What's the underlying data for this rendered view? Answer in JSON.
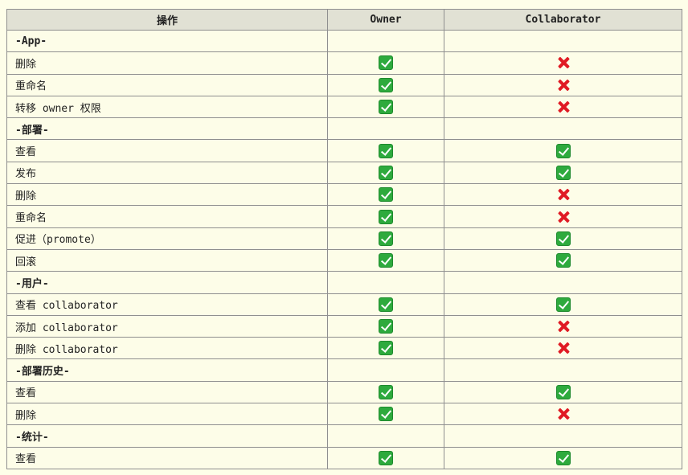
{
  "table": {
    "headers": [
      "操作",
      "Owner",
      "Collaborator"
    ],
    "rows": [
      {
        "kind": "group",
        "label": "-App-"
      },
      {
        "kind": "item",
        "label": "删除",
        "owner": "check-icon",
        "collaborator": "cross-icon"
      },
      {
        "kind": "item",
        "label": "重命名",
        "owner": "check-icon",
        "collaborator": "cross-icon"
      },
      {
        "kind": "item",
        "label": "转移 owner 权限",
        "owner": "check-icon",
        "collaborator": "cross-icon"
      },
      {
        "kind": "group",
        "label": "-部署-"
      },
      {
        "kind": "item",
        "label": "查看",
        "owner": "check-icon",
        "collaborator": "check-icon"
      },
      {
        "kind": "item",
        "label": "发布",
        "owner": "check-icon",
        "collaborator": "check-icon"
      },
      {
        "kind": "item",
        "label": "删除",
        "owner": "check-icon",
        "collaborator": "cross-icon"
      },
      {
        "kind": "item",
        "label": "重命名",
        "owner": "check-icon",
        "collaborator": "cross-icon"
      },
      {
        "kind": "item",
        "label": "促进（promote）",
        "owner": "check-icon",
        "collaborator": "check-icon"
      },
      {
        "kind": "item",
        "label": "回滚",
        "owner": "check-icon",
        "collaborator": "check-icon"
      },
      {
        "kind": "group",
        "label": "-用户-"
      },
      {
        "kind": "item",
        "label": "查看 collaborator",
        "owner": "check-icon",
        "collaborator": "check-icon"
      },
      {
        "kind": "item",
        "label": "添加 collaborator",
        "owner": "check-icon",
        "collaborator": "cross-icon"
      },
      {
        "kind": "item",
        "label": "删除 collaborator",
        "owner": "check-icon",
        "collaborator": "cross-icon"
      },
      {
        "kind": "group",
        "label": "-部署历史-"
      },
      {
        "kind": "item",
        "label": "查看",
        "owner": "check-icon",
        "collaborator": "check-icon"
      },
      {
        "kind": "item",
        "label": "删除",
        "owner": "check-icon",
        "collaborator": "cross-icon"
      },
      {
        "kind": "group",
        "label": "-统计-"
      },
      {
        "kind": "item",
        "label": "查看",
        "owner": "check-icon",
        "collaborator": "check-icon"
      }
    ]
  },
  "colors": {
    "background": "#fefee9",
    "header_background": "#e1e1d4",
    "check": "#2eaa3d",
    "cross": "#e01b24"
  }
}
